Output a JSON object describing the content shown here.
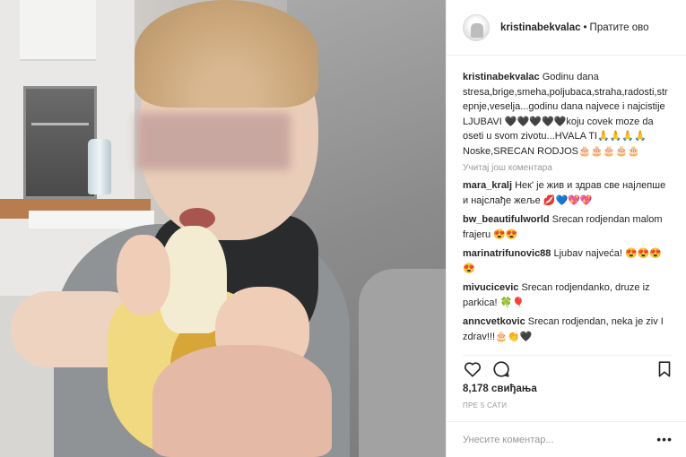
{
  "header": {
    "username": "kristinabekvalac",
    "separator": "•",
    "follow_label": "Пратите ово"
  },
  "caption": {
    "username": "kristinabekvalac",
    "text": "Godinu dana stresa,brige,smeha,poljubaca,straha,radosti,strepnje,veselja...godinu dana najvece i najcistije LJUBAVI 🖤🖤🖤🖤🖤koju covek moze da oseti u svom zivotu...HVALA TI🙏🙏🙏🙏Noske,SRECAN RODJOS🎂🎂🎂🎂🎂"
  },
  "load_more_label": "Учитај још коментара",
  "comments": [
    {
      "username": "mara_kralj",
      "text": "Нек' је жив и здрав све најлепше и најслађе жеље 💋💙💖💖"
    },
    {
      "username": "bw_beautifulworld",
      "text": "Srecan rodjendan malom frajeru 😍😍"
    },
    {
      "username": "marinatrifunovic88",
      "text": "Ljubav najveća! 😍😍😍😍"
    },
    {
      "username": "mivucicevic",
      "text": "Srecan rodjendanko, druze iz parkica! 🍀🎈"
    },
    {
      "username": "anncvetkovic",
      "text": "Srecan rodjendan, neka je ziv I zdrav!!!🎂👏🖤"
    }
  ],
  "actions": {
    "like_icon": "heart-outline-icon",
    "comment_icon": "speech-bubble-icon",
    "save_icon": "bookmark-icon"
  },
  "likes_text": "8,178 свиђања",
  "time_text": "ПРЕ 5 САТИ",
  "composer": {
    "placeholder": "Унесите коментар...",
    "more_label": "•••"
  }
}
